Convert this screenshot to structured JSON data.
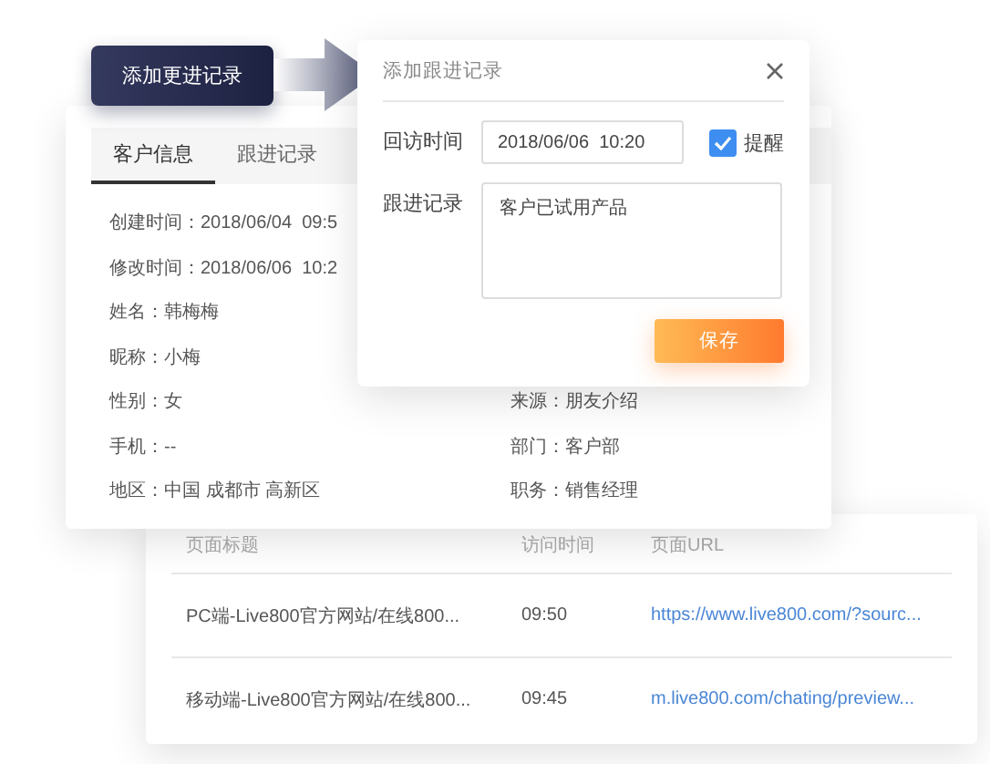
{
  "floating_button": {
    "label": "添加更进记录"
  },
  "customer_card": {
    "tabs": [
      {
        "label": "客户信息",
        "selected": true
      },
      {
        "label": "跟进记录",
        "selected": false
      }
    ],
    "rows": [
      {
        "left": "创建时间：2018/06/04  09:5"
      },
      {
        "left": "修改时间：2018/06/06  10:2"
      },
      {
        "left": "姓名：韩梅梅"
      },
      {
        "left": "昵称：小梅"
      },
      {
        "left": "性别：女",
        "right": "来源：朋友介绍"
      },
      {
        "left": "手机：--",
        "right": "部门：客户部"
      },
      {
        "left": "地区：中国 成都市 高新区",
        "right": "职务：销售经理"
      }
    ]
  },
  "dialog": {
    "title": "添加跟进记录",
    "fields": [
      {
        "label": "回访时间",
        "kind": "input",
        "value": "2018/06/06  10:20",
        "reminder": {
          "label": "提醒",
          "checked": true
        }
      },
      {
        "label": "跟进记录",
        "kind": "textarea",
        "value": "客户已试用产品"
      }
    ],
    "save_button": "保存"
  },
  "visits": {
    "columns": [
      "页面标题",
      "访问时间",
      "页面URL"
    ],
    "rows": [
      {
        "title": "PC端-Live800官方网站/在线800...",
        "time": "09:50",
        "url": "https://www.live800.com/?sourc..."
      },
      {
        "title": "移动端-Live800官方网站/在线800...",
        "time": "09:45",
        "url": "m.live800.com/chating/preview..."
      }
    ]
  }
}
